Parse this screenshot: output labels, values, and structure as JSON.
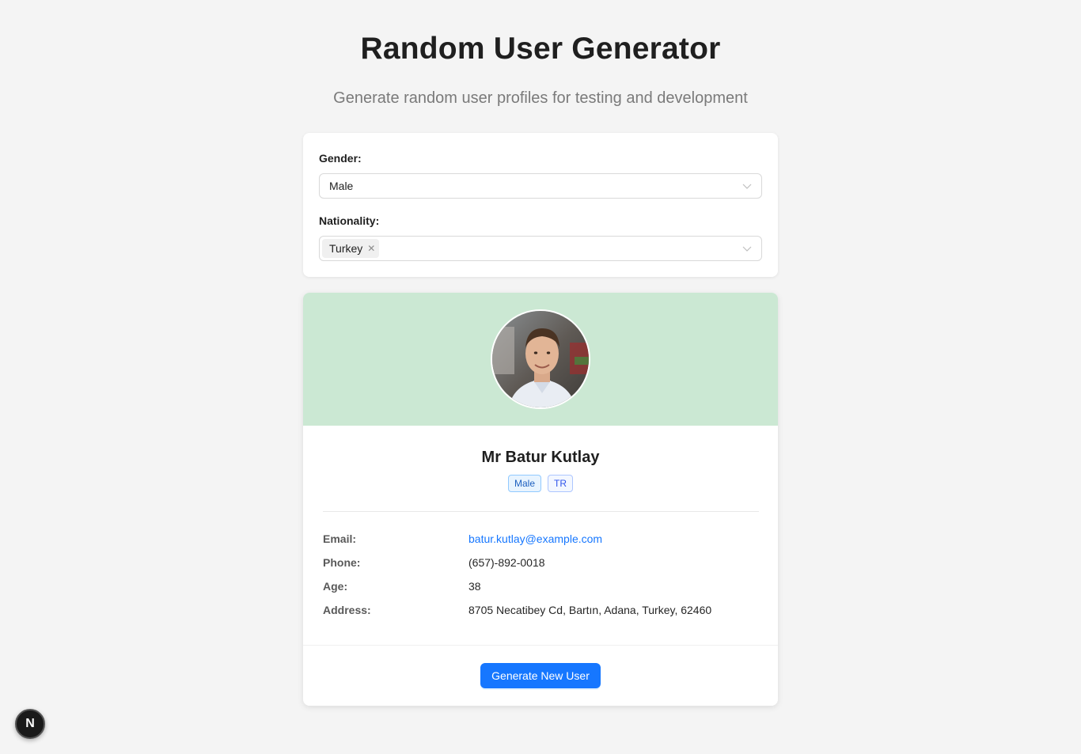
{
  "header": {
    "title": "Random User Generator",
    "subtitle": "Generate random user profiles for testing and development"
  },
  "filters": {
    "gender_label": "Gender:",
    "gender_value": "Male",
    "nationality_label": "Nationality:",
    "nationality_tags": [
      "Turkey"
    ]
  },
  "user": {
    "name": "Mr Batur Kutlay",
    "badges": [
      "Male",
      "TR"
    ],
    "fields": [
      {
        "key": "Email:",
        "value": "batur.kutlay@example.com",
        "is_link": true
      },
      {
        "key": "Phone:",
        "value": "(657)-892-0018",
        "is_link": false
      },
      {
        "key": "Age:",
        "value": "38",
        "is_link": false
      },
      {
        "key": "Address:",
        "value": "8705 Necatibey Cd, Bartın, Adana, Turkey, 62460",
        "is_link": false
      }
    ]
  },
  "actions": {
    "generate_label": "Generate New User"
  },
  "dev_badge": {
    "letter": "N"
  },
  "colors": {
    "accent": "#1677ff",
    "header_bg": "#cbe8d3",
    "page_bg": "#f4f4f4"
  }
}
